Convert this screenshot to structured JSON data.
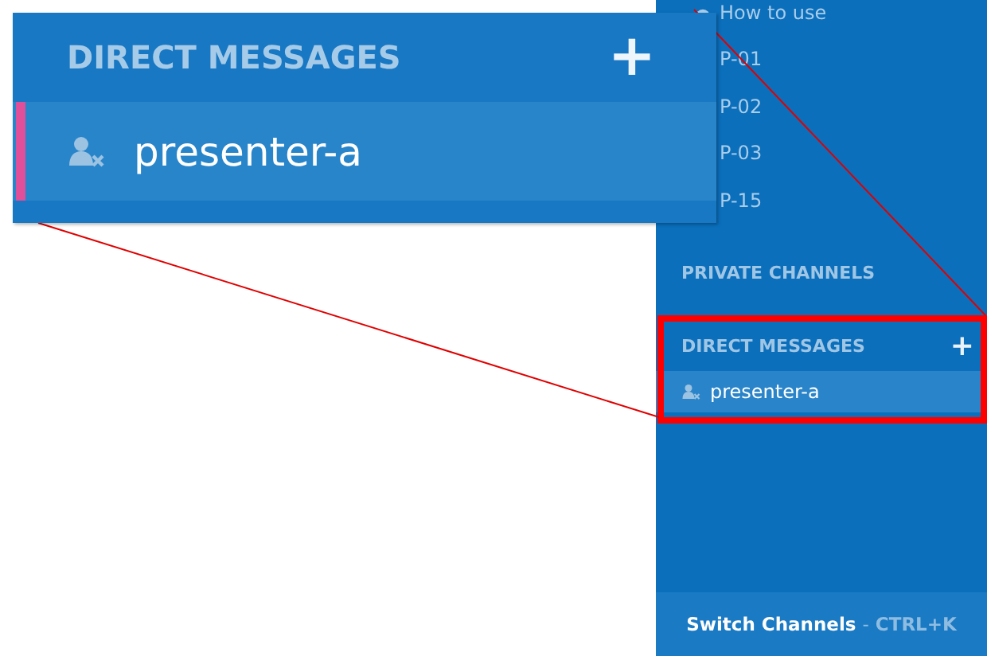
{
  "sidebar": {
    "channels": [
      {
        "name": "How to use",
        "kind": "pinned"
      },
      {
        "name": "P-01",
        "kind": "plain"
      },
      {
        "name": "P-02",
        "kind": "plain"
      },
      {
        "name": "P-03",
        "kind": "plain"
      },
      {
        "name": "P-15",
        "kind": "plain"
      }
    ],
    "private_channels": {
      "title": "PRIVATE CHANNELS"
    },
    "direct_messages": {
      "title": "DIRECT MESSAGES",
      "add": "+",
      "items": [
        {
          "name": "presenter-a",
          "selected": true
        }
      ]
    },
    "footer": {
      "label": "Switch Channels",
      "separator": "-",
      "shortcut": "CTRL+K"
    }
  },
  "callout": {
    "title": "DIRECT MESSAGES",
    "add": "+",
    "items": [
      {
        "name": "presenter-a",
        "selected": true
      }
    ]
  }
}
